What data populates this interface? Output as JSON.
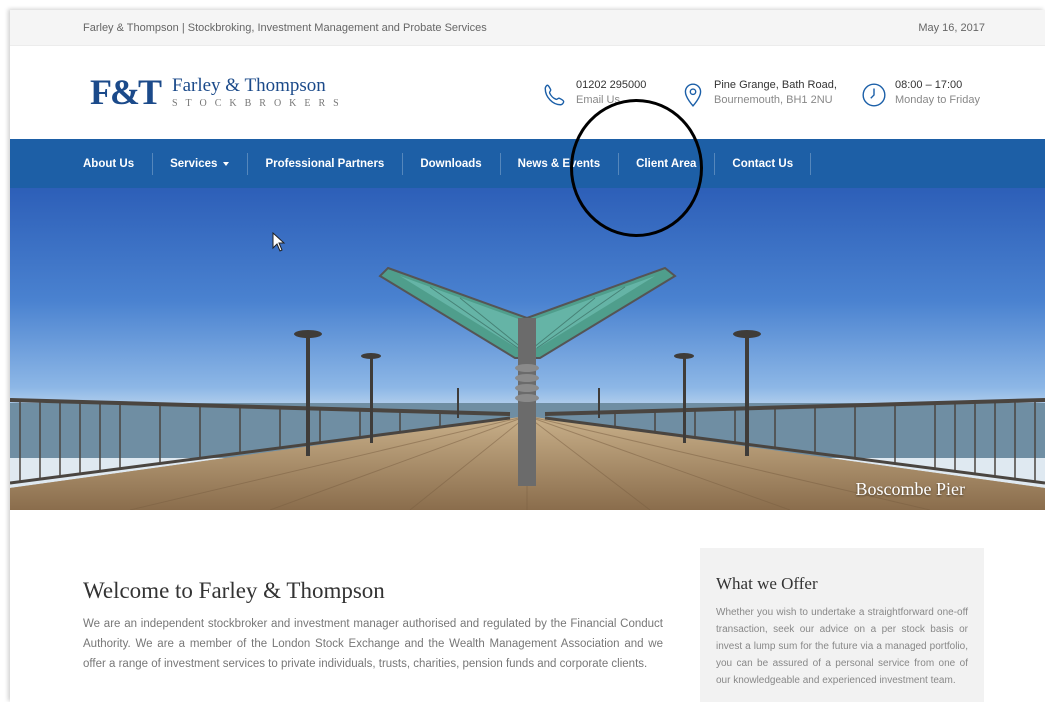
{
  "topbar": {
    "tagline": "Farley & Thompson | Stockbroking, Investment Management and Probate Services",
    "date": "May 16, 2017"
  },
  "header": {
    "logo_mark": "F&T",
    "logo_name": "Farley & Thompson",
    "logo_sub": "STOCKBROKERS",
    "phone": {
      "icon": "phone-icon",
      "line1": "01202 295000",
      "line2": "Email Us"
    },
    "address": {
      "icon": "location-pin-icon",
      "line1": "Pine Grange, Bath Road,",
      "line2": "Bournemouth, BH1 2NU"
    },
    "hours": {
      "icon": "clock-icon",
      "line1": "08:00 – 17:00",
      "line2": "Monday to Friday"
    }
  },
  "nav": {
    "items": [
      {
        "label": "About Us"
      },
      {
        "label": "Services"
      },
      {
        "label": "Professional Partners"
      },
      {
        "label": "Downloads"
      },
      {
        "label": "News & Events"
      },
      {
        "label": "Client Area"
      },
      {
        "label": "Contact Us"
      }
    ]
  },
  "hero": {
    "caption": "Boscombe Pier"
  },
  "welcome": {
    "title": "Welcome to Farley & Thompson",
    "body": "We are an independent stockbroker and investment manager authorised and regulated by the Financial Conduct Authority. We are a member of the London Stock Exchange and the Wealth Management Association and we offer a range of investment services to private individuals, trusts, charities, pension funds and corporate clients."
  },
  "offer": {
    "title": "What we Offer",
    "body": "Whether you wish to undertake a straightforward one-off transaction, seek our advice on a per stock basis or invest a lump sum for the future via a managed portfolio, you can be assured of a personal service from one of our knowledgeable and experienced investment team."
  },
  "colors": {
    "brand_blue": "#1d5fa6",
    "logo_blue": "#1b4a8a",
    "annotation": "#000000"
  }
}
